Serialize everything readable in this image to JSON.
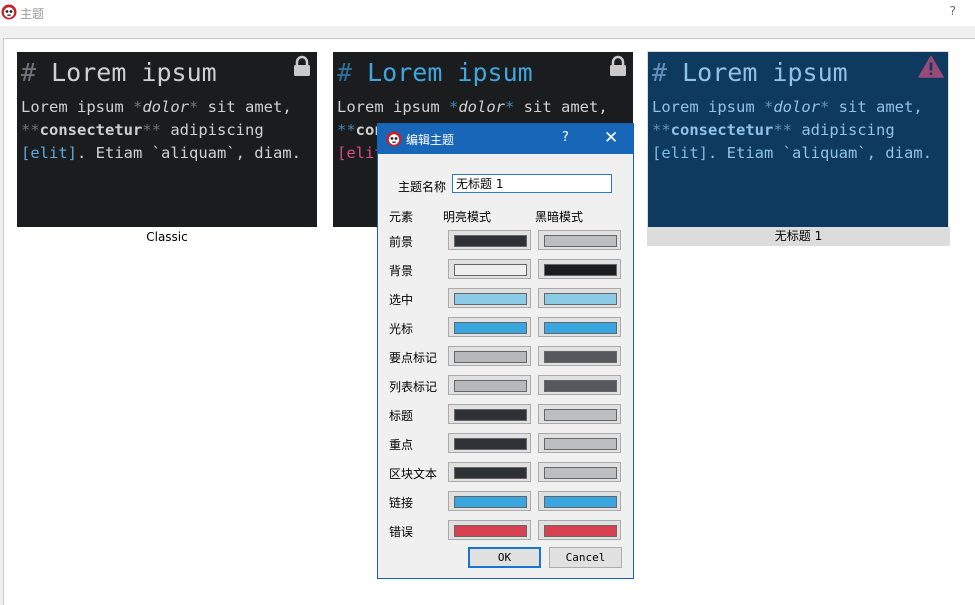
{
  "window": {
    "title": "主题",
    "help": "?"
  },
  "previews": {
    "heading_hash": "#",
    "heading_text": " Lorem ipsum",
    "body": {
      "t1": "Lorem ipsum ",
      "star1": "*",
      "em": "dolor",
      "star2": "*",
      "t2": " sit amet,",
      "strong_mark1": "**",
      "strong": "consectetur",
      "strong_mark2": "**",
      "t3": " adipiscing ",
      "link": "[elit]",
      "t4": ". Etiam `aliquam`, diam."
    }
  },
  "themes": [
    {
      "name": "Classic",
      "icon": "lock-icon"
    },
    {
      "name": "",
      "icon": "lock-icon"
    },
    {
      "name": "无标题 1",
      "icon": "warning-icon",
      "selected": true
    }
  ],
  "dialog": {
    "title": "编辑主题",
    "help": "?",
    "close": "✕",
    "name_label": "主题名称",
    "name_value": "无标题 1",
    "col_element": "元素",
    "col_light": "明亮模式",
    "col_dark": "黑暗模式",
    "rows": [
      {
        "label": "前景",
        "light": "#2e3236",
        "dark": "#bcbec0"
      },
      {
        "label": "背景",
        "light": "#efefef",
        "dark": "#1b1c1e"
      },
      {
        "label": "选中",
        "light": "#8ccbe6",
        "dark": "#8ccbe6"
      },
      {
        "label": "光标",
        "light": "#3aa6e0",
        "dark": "#3aa6e0"
      },
      {
        "label": "要点标记",
        "light": "#b6b8ba",
        "dark": "#55585c"
      },
      {
        "label": "列表标记",
        "light": "#b6b8ba",
        "dark": "#55585c"
      },
      {
        "label": "标题",
        "light": "#2e3236",
        "dark": "#bcbec0"
      },
      {
        "label": "重点",
        "light": "#2e3236",
        "dark": "#bcbec0"
      },
      {
        "label": "区块文本",
        "light": "#2e3236",
        "dark": "#bcbec0"
      },
      {
        "label": "链接",
        "light": "#3aa6e0",
        "dark": "#3aa6e0"
      },
      {
        "label": "错误",
        "light": "#d8414f",
        "dark": "#d8414f"
      }
    ],
    "ok": "OK",
    "cancel": "Cancel"
  }
}
